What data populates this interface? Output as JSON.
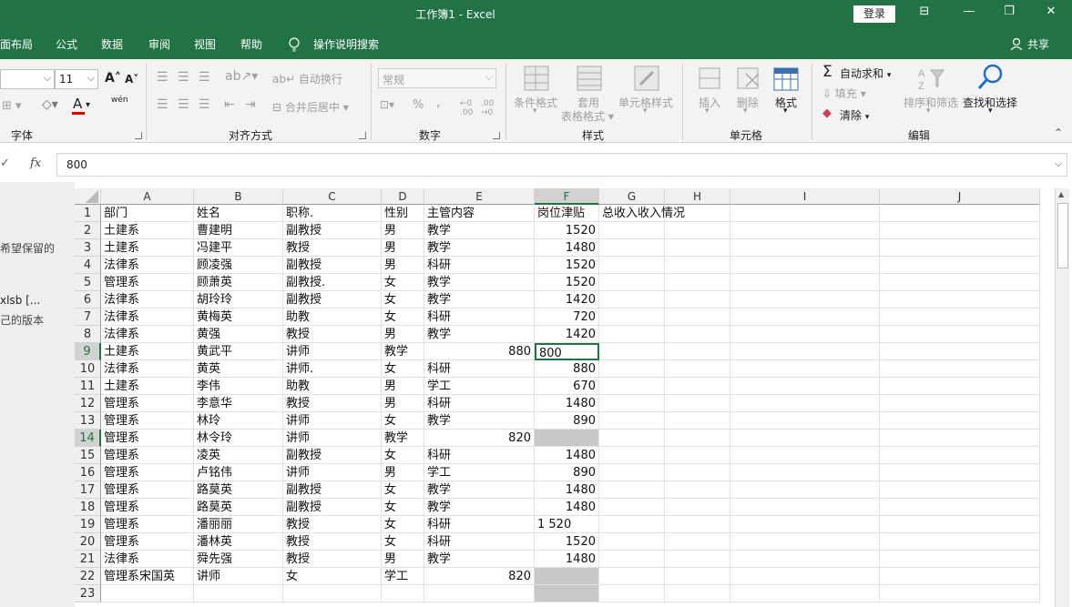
{
  "title": "工作簿1  -  Excel",
  "login": "登录",
  "window_buttons": [
    "⊟",
    "—",
    "❐",
    "✕"
  ],
  "menu": [
    "面布局",
    "公式",
    "数据",
    "审阅",
    "视图",
    "帮助"
  ],
  "tell_me": "操作说明搜索",
  "share": "共享",
  "ribbon": {
    "font": {
      "size": "11",
      "label": "字体",
      "wen": "wén"
    },
    "align": {
      "wrap": "自动换行",
      "merge": "合并后居中",
      "label": "对齐方式"
    },
    "number": {
      "format": "常规",
      "pct": "%",
      "comma": ",",
      "label": "数字"
    },
    "styles": {
      "cond": "条件格式",
      "table1": "套用",
      "table2": "表格格式",
      "cell": "单元格样式",
      "label": "样式"
    },
    "cells": {
      "insert": "插入",
      "delete": "删除",
      "format": "格式",
      "label": "单元格"
    },
    "edit": {
      "autosum": "自动求和",
      "fill": "填充",
      "clear": "清除",
      "sort": "排序和筛选",
      "find": "查找和选择",
      "label": "编辑"
    }
  },
  "formula": {
    "value": "800",
    "fx": "fx"
  },
  "left_panel": [
    "希望保留的",
    "xlsb  [...",
    "己的版本"
  ],
  "columns": [
    "A",
    "B",
    "C",
    "D",
    "E",
    "F",
    "G",
    "H",
    "I",
    "J"
  ],
  "rows": [
    [
      "部门",
      "姓名",
      "职称.",
      "性别",
      "主管内容",
      "岗位津贴",
      "总收入收入情况",
      "",
      "",
      ""
    ],
    [
      "土建系",
      "曹建明",
      "副教授",
      "男",
      "教学",
      "1520",
      "",
      "",
      "",
      ""
    ],
    [
      "土建系",
      "冯建平",
      "教授",
      "男",
      "教学",
      "1480",
      "",
      "",
      "",
      ""
    ],
    [
      "法律系",
      "顾凌强",
      "副教授",
      "男",
      "科研",
      "1520",
      "",
      "",
      "",
      ""
    ],
    [
      "管理系",
      "顾萧英",
      "副教授.",
      "女",
      "教学",
      "1520",
      "",
      "",
      "",
      ""
    ],
    [
      "法律系",
      "胡玲玲",
      "副教授",
      "女",
      "教学",
      "1420",
      "",
      "",
      "",
      ""
    ],
    [
      "法律系",
      "黄梅英",
      "助教",
      "女",
      "科研",
      "720",
      "",
      "",
      "",
      ""
    ],
    [
      "法律系",
      "黄强",
      "教授",
      "男",
      "教学",
      "1420",
      "",
      "",
      "",
      ""
    ],
    [
      "土建系",
      "黄武平",
      "讲师",
      "教学",
      "880",
      "800",
      "",
      "",
      "",
      ""
    ],
    [
      "法律系",
      "黄英",
      "讲师.",
      "女",
      "科研",
      "880",
      "",
      "",
      "",
      ""
    ],
    [
      "土建系",
      "李伟",
      "助教",
      "男",
      "学工",
      "670",
      "",
      "",
      "",
      ""
    ],
    [
      "管理系",
      "李意华",
      "教授",
      "男",
      "科研",
      "1480",
      "",
      "",
      "",
      ""
    ],
    [
      "管理系",
      "林玲",
      "讲师",
      "女",
      "教学",
      "890",
      "",
      "",
      "",
      ""
    ],
    [
      "管理系",
      "林令玲",
      "讲师",
      "教学",
      "820",
      "",
      "",
      "",
      "",
      ""
    ],
    [
      "管理系",
      "凌英",
      "副教授",
      "女",
      "科研",
      "1480",
      "",
      "",
      "",
      ""
    ],
    [
      "管理系",
      "卢铭伟",
      "讲师",
      "男",
      "学工",
      "890",
      "",
      "",
      "",
      ""
    ],
    [
      "管理系",
      "路莫英",
      "副教授",
      "女",
      "教学",
      "1480",
      "",
      "",
      "",
      ""
    ],
    [
      "管理系",
      "路莫英",
      "副教授",
      "女",
      "教学",
      "1480",
      "",
      "",
      "",
      ""
    ],
    [
      "管理系",
      "潘丽丽",
      "教授",
      "女",
      "科研",
      "1 520",
      "",
      "",
      "",
      ""
    ],
    [
      "管理系",
      "潘林英",
      "教授",
      "女",
      "科研",
      "1520",
      "",
      "",
      "",
      ""
    ],
    [
      "法律系",
      "舜先强",
      "教授",
      "男",
      "教学",
      "1480",
      "",
      "",
      "",
      ""
    ],
    [
      "管理系宋国英",
      "讲师",
      "女",
      "学工",
      "820",
      "",
      "",
      "",
      "",
      ""
    ],
    [
      "",
      "",
      "",
      "",
      "",
      "",
      "",
      "",
      "",
      ""
    ]
  ],
  "colors": {
    "accent": "#217346",
    "gray_cell": "#c8c8c8"
  }
}
